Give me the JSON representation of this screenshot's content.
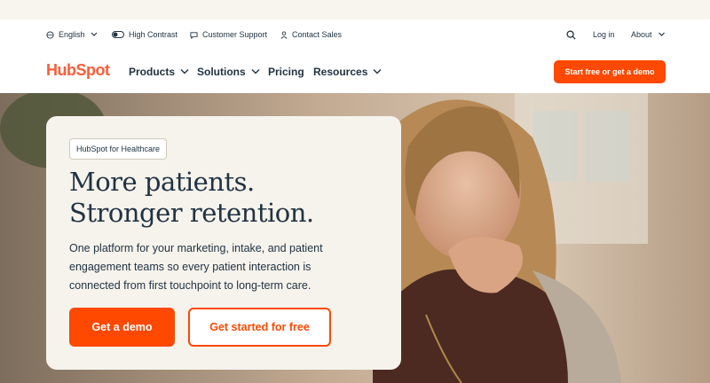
{
  "utility": {
    "language": "English",
    "contrast": "High Contrast",
    "support": "Customer Support",
    "sales": "Contact Sales",
    "login": "Log in",
    "about": "About"
  },
  "nav": {
    "logo": "HubSpot",
    "items": [
      {
        "label": "Products"
      },
      {
        "label": "Solutions"
      },
      {
        "label": "Pricing"
      },
      {
        "label": "Resources"
      }
    ],
    "cta": "Start free or get a demo"
  },
  "hero": {
    "tag": "HubSpot for Healthcare",
    "headline_line1": "More patients.",
    "headline_line2": "Stronger retention.",
    "subtext": "One platform for your marketing, intake, and patient engagement teams so every patient interaction is connected from first touchpoint to long-term care.",
    "primary_button": "Get a demo",
    "secondary_button": "Get started for free"
  },
  "colors": {
    "brand": "#ff5c35",
    "cta": "#ff4800",
    "text": "#213343",
    "card": "#f6f3ec"
  }
}
